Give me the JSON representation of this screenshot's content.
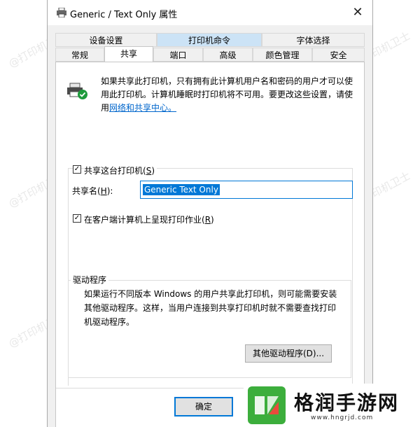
{
  "window": {
    "title": "Generic / Text Only 属性",
    "close_glyph": "✕"
  },
  "tabs_row1": [
    {
      "label": "设备设置"
    },
    {
      "label": "打印机命令"
    },
    {
      "label": "字体选择"
    }
  ],
  "tabs_row2": [
    {
      "label": "常规"
    },
    {
      "label": "共享"
    },
    {
      "label": "端口"
    },
    {
      "label": "高级"
    },
    {
      "label": "颜色管理"
    },
    {
      "label": "安全"
    }
  ],
  "selected_tab": "共享",
  "description": {
    "text": "如果共享此打印机，只有拥有此计算机用户名和密码的用户才可以使用此打印机。计算机睡眠时打印机将不可用。要更改这些设置，请使用",
    "link": "网络和共享中心。"
  },
  "share_printer": {
    "label": "共享这台打印机(",
    "hotkey": "S",
    "suffix": ")",
    "checked": true,
    "check_glyph": "✓"
  },
  "share_name": {
    "label": "共享名(",
    "hotkey": "H",
    "suffix": "):",
    "value": "Generic  Text Only"
  },
  "render_jobs": {
    "label": "在客户端计算机上呈现打印作业(",
    "hotkey": "R",
    "suffix": ")",
    "checked": true,
    "check_glyph": "✓"
  },
  "drivers": {
    "title": "驱动程序",
    "text": "如果运行不同版本 Windows 的用户共享此打印机，则可能需要安装其他驱动程序。这样，当用户连接到共享打印机时就不需要查找打印机驱动程序。",
    "button": "其他驱动程序(D)..."
  },
  "footer": {
    "ok": "确定"
  },
  "watermark": "@打印机卫士",
  "logo": {
    "name": "格润手游网",
    "url": "www.hngrjd.com"
  },
  "colors": {
    "accent": "#0078d7",
    "tab_highlight": "#cce3f6",
    "logo_green": "#3cae3c"
  },
  "icons": [
    "printer-icon",
    "shared-printer-icon",
    "close-icon",
    "logo-icon"
  ]
}
